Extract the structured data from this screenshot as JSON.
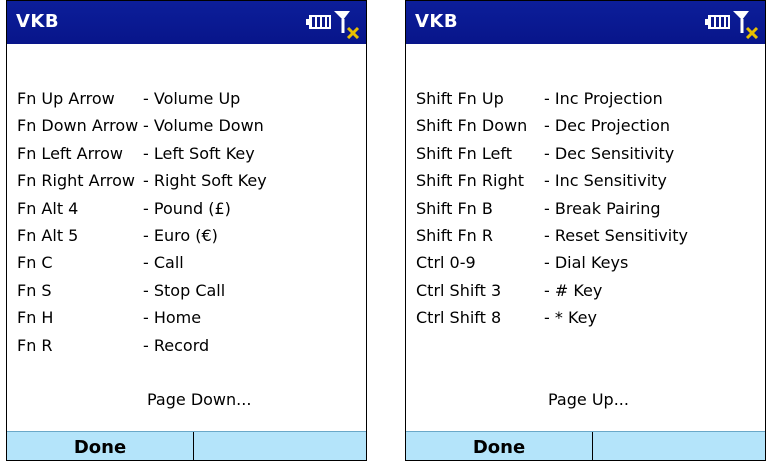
{
  "colors": {
    "title_bar": "#0c1e9a",
    "softkey_bar": "#b4e4fa",
    "background": "#ffffff",
    "signal_x": "#e8bf00"
  },
  "screens": [
    {
      "title": "VKB",
      "rows": [
        {
          "key": "Fn Up Arrow",
          "desc": "- Volume Up"
        },
        {
          "key": "Fn Down Arrow",
          "desc": "- Volume Down"
        },
        {
          "key": "Fn Left Arrow",
          "desc": "- Left Soft Key"
        },
        {
          "key": "Fn Right Arrow",
          "desc": "- Right Soft Key"
        },
        {
          "key": "Fn Alt 4",
          "desc": "- Pound (£)"
        },
        {
          "key": "Fn Alt 5",
          "desc": "- Euro (€)"
        },
        {
          "key": "Fn C",
          "desc": "- Call"
        },
        {
          "key": "Fn S",
          "desc": "- Stop Call"
        },
        {
          "key": "Fn H",
          "desc": "- Home"
        },
        {
          "key": "Fn R",
          "desc": "- Record"
        }
      ],
      "page_link": "Page Down...",
      "left_softkey": "Done",
      "right_softkey": "",
      "icons": [
        "battery-icon",
        "signal-off-icon"
      ]
    },
    {
      "title": "VKB",
      "rows": [
        {
          "key": "Shift Fn Up",
          "desc": "- Inc Projection"
        },
        {
          "key": "Shift Fn Down",
          "desc": "- Dec Projection"
        },
        {
          "key": "Shift Fn Left",
          "desc": "- Dec Sensitivity"
        },
        {
          "key": "Shift Fn Right",
          "desc": "- Inc Sensitivity"
        },
        {
          "key": "Shift Fn B",
          "desc": "- Break Pairing"
        },
        {
          "key": "Shift Fn R",
          "desc": "- Reset Sensitivity"
        },
        {
          "key": "Ctrl 0-9",
          "desc": "- Dial Keys"
        },
        {
          "key": "Ctrl Shift 3",
          "desc": "- # Key"
        },
        {
          "key": "Ctrl Shift 8",
          "desc": "- * Key"
        }
      ],
      "page_link": "Page Up...",
      "left_softkey": "Done",
      "right_softkey": "",
      "icons": [
        "battery-icon",
        "signal-off-icon"
      ]
    }
  ]
}
